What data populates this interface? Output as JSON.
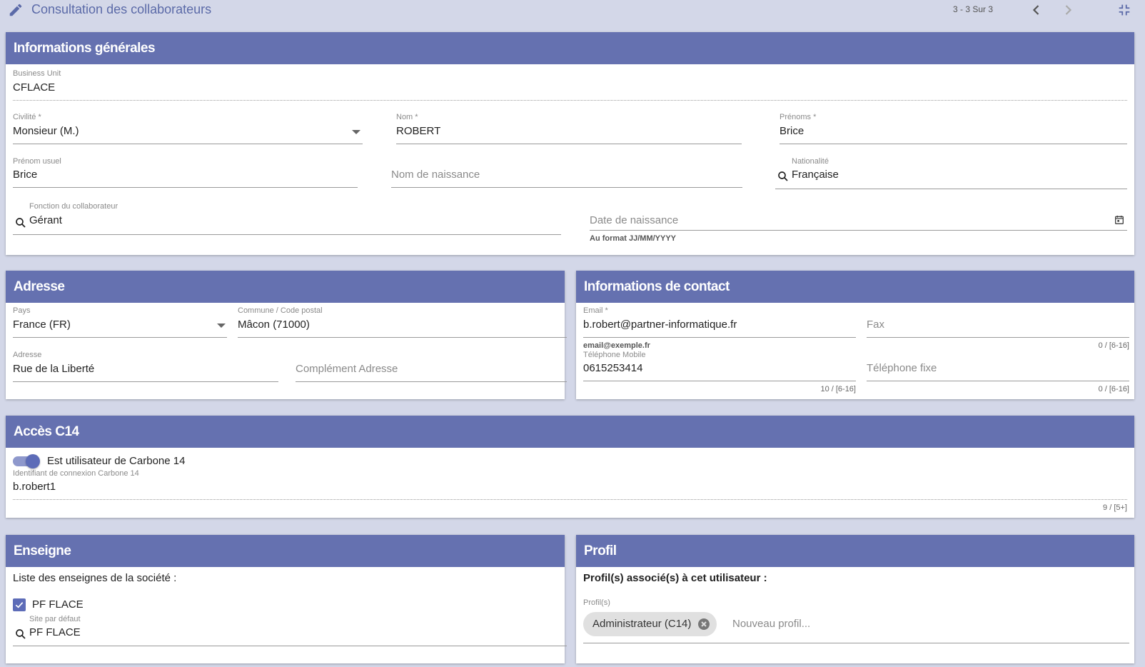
{
  "header": {
    "title": "Consultation des collaborateurs",
    "pager": "3 - 3 Sur 3"
  },
  "general": {
    "heading": "Informations générales",
    "business_unit": {
      "label": "Business Unit",
      "value": "CFLACE"
    },
    "civilite": {
      "label": "Civilité *",
      "value": "Monsieur (M.)"
    },
    "nom": {
      "label": "Nom *",
      "value": "ROBERT"
    },
    "prenoms": {
      "label": "Prénoms *",
      "value": "Brice"
    },
    "prenom_usuel": {
      "label": "Prénom usuel",
      "value": "Brice"
    },
    "nom_naissance": {
      "placeholder": "Nom de naissance"
    },
    "nationalite": {
      "label": "Nationalité",
      "value": "Française"
    },
    "fonction": {
      "label": "Fonction du collaborateur",
      "value": "Gérant"
    },
    "date_naissance": {
      "placeholder": "Date de naissance",
      "hint": "Au format JJ/MM/YYYY"
    }
  },
  "address": {
    "heading": "Adresse",
    "pays": {
      "label": "Pays",
      "value": "France (FR)"
    },
    "commune": {
      "label": "Commune / Code postal",
      "value": "Mâcon (71000)"
    },
    "adresse": {
      "label": "Adresse",
      "value": "Rue de la Liberté"
    },
    "complement": {
      "placeholder": "Complément Adresse"
    }
  },
  "contact": {
    "heading": "Informations de contact",
    "email": {
      "label": "Email *",
      "value": "b.robert@partner-informatique.fr",
      "hint": "email@exemple.fr"
    },
    "fax": {
      "placeholder": "Fax",
      "counter": "0 / [6-16]"
    },
    "mobile": {
      "label": "Téléphone Mobile",
      "value": "0615253414",
      "counter": "10 / [6-16]"
    },
    "fixe": {
      "placeholder": "Téléphone fixe",
      "counter": "0 / [6-16]"
    }
  },
  "c14": {
    "heading": "Accès C14",
    "toggle_label": "Est utilisateur de Carbone 14",
    "toggle_on": true,
    "login": {
      "label": "Identifiant de connexion Carbone 14",
      "value": "b.robert1",
      "counter": "9 / [5+]"
    }
  },
  "enseigne": {
    "heading": "Enseigne",
    "list_title": "Liste des enseignes de la société :",
    "items": [
      {
        "label": "PF FLACE",
        "checked": true
      }
    ],
    "site": {
      "label": "Site par défaut",
      "value": "PF FLACE"
    }
  },
  "profil": {
    "heading": "Profil",
    "intro": "Profil(s) associé(s) à cet utilisateur :",
    "label": "Profil(s)",
    "chips": [
      "Administrateur (C14)"
    ],
    "placeholder": "Nouveau profil..."
  },
  "colors": {
    "accent": "#6571b0",
    "page_bg": "#d3d7e8"
  },
  "icons": {
    "title": "pencil-icon",
    "nav": [
      "chevron-left-icon",
      "chevron-right-icon"
    ],
    "collapse": "collapse-icon",
    "lookup": "search-icon",
    "date": "calendar-icon",
    "chip_remove": "close-circle-icon"
  }
}
